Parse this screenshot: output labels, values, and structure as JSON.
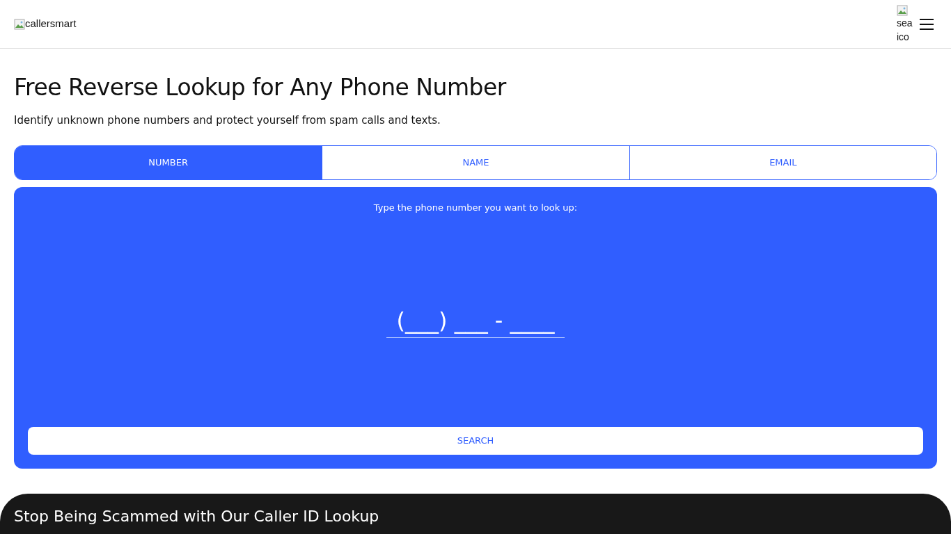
{
  "header": {
    "logo_alt": "callersmart",
    "search_icon_alt": "sea ico"
  },
  "hero": {
    "title": "Free Reverse Lookup for Any Phone Number",
    "subtitle": "Identify unknown phone numbers and protect yourself from spam calls and texts."
  },
  "tabs": [
    {
      "label": "NUMBER",
      "selected": true
    },
    {
      "label": "NAME",
      "selected": false
    },
    {
      "label": "EMAIL",
      "selected": false
    }
  ],
  "search_panel": {
    "prompt": "Type the phone number you want to look up:",
    "phone_field": {
      "placeholder": "(___) ___ - ____"
    },
    "button": "SEARCH"
  },
  "next_section": {
    "title": "Stop Being Scammed with Our Caller ID Lookup"
  }
}
